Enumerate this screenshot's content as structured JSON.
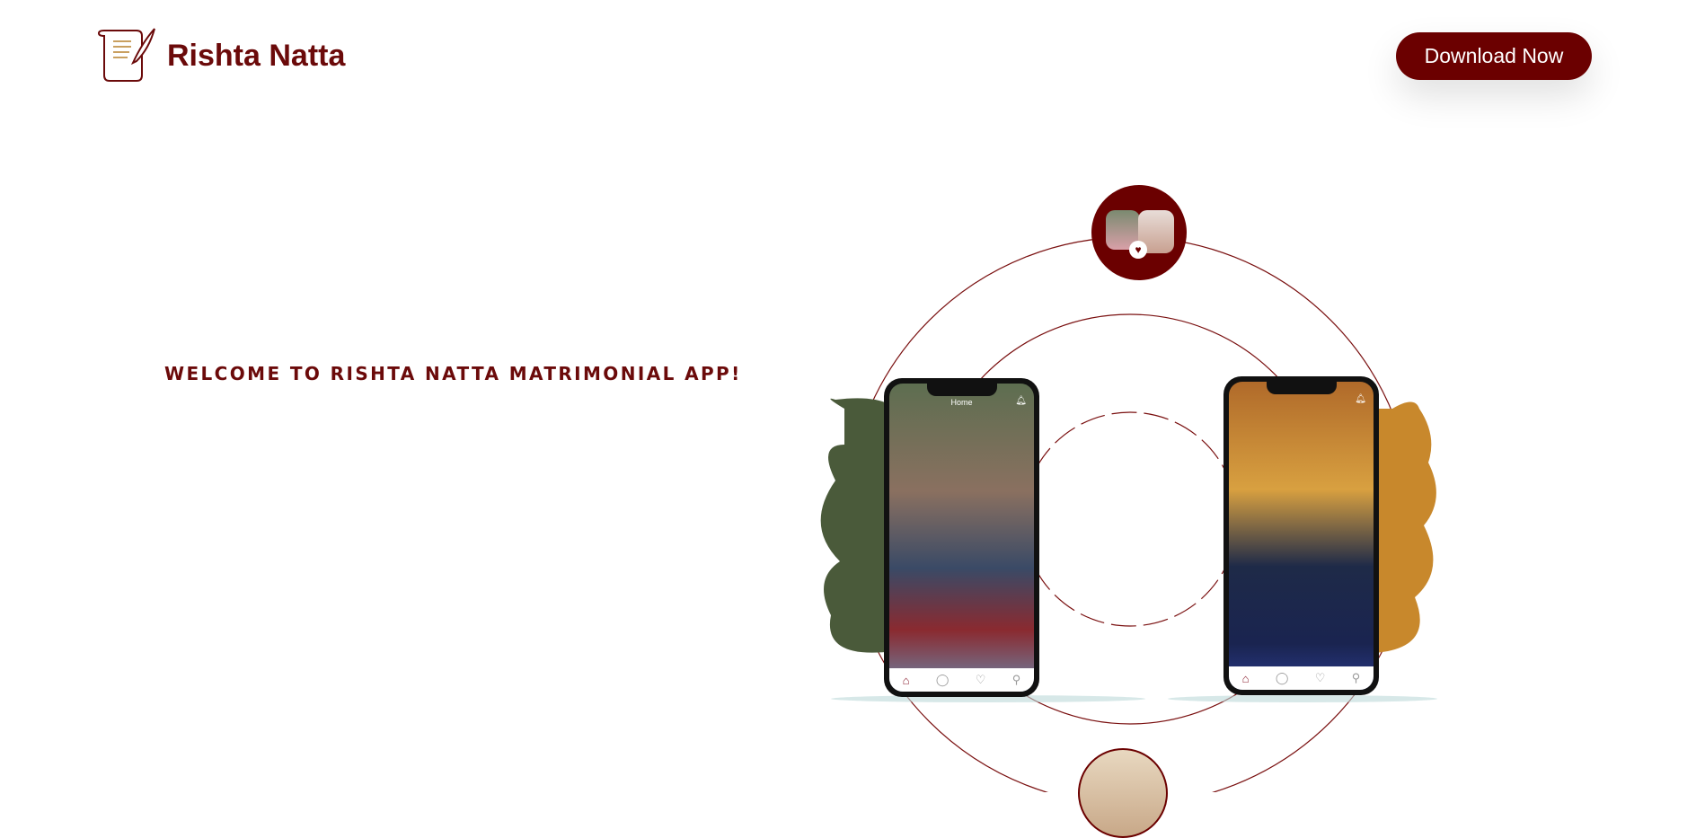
{
  "header": {
    "logo_text": "Rishta Natta",
    "download_label": "Download Now"
  },
  "hero": {
    "welcome": "WELCOME TO RISHTA NATTA MATRIMONIAL APP!"
  },
  "phones": [
    {
      "screen_title": "Home",
      "nav_icons": [
        "home-icon",
        "chat-icon",
        "heart-icon",
        "profile-icon"
      ]
    },
    {
      "screen_title": "",
      "nav_icons": [
        "home-icon",
        "chat-icon",
        "heart-icon",
        "profile-icon"
      ]
    }
  ],
  "colors": {
    "brand": "#6b0000",
    "ring": "#7a1010"
  }
}
